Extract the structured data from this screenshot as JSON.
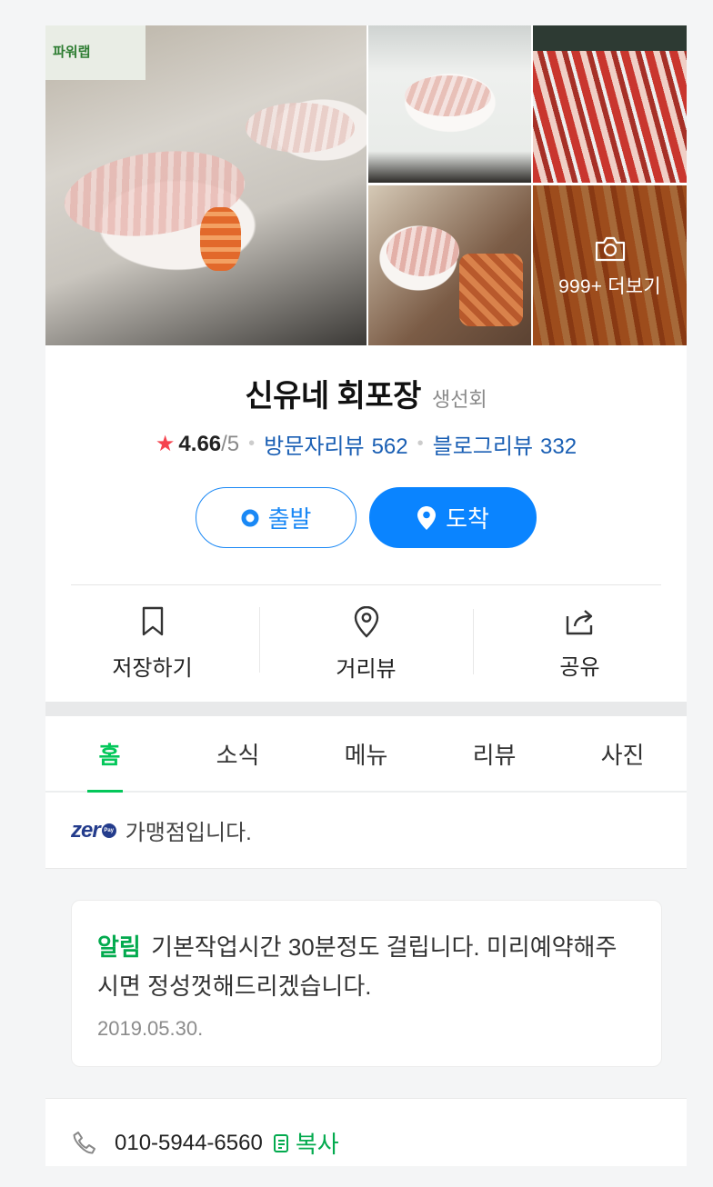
{
  "photos": {
    "more_label": "999+ 더보기",
    "main_logo_text": "파워랩"
  },
  "place": {
    "name": "신유네 회포장",
    "category": "생선회",
    "rating": "4.66",
    "rating_max": "/5",
    "visitor_review_label": "방문자리뷰",
    "visitor_review_count": "562",
    "blog_review_label": "블로그리뷰",
    "blog_review_count": "332"
  },
  "route": {
    "departure_label": "출발",
    "arrival_label": "도착"
  },
  "actions": {
    "save_label": "저장하기",
    "streetview_label": "거리뷰",
    "share_label": "공유"
  },
  "tabs": [
    {
      "label": "홈",
      "active": true
    },
    {
      "label": "소식"
    },
    {
      "label": "메뉴"
    },
    {
      "label": "리뷰"
    },
    {
      "label": "사진"
    }
  ],
  "zeropay": {
    "logo": "zer",
    "pay_badge": "Pay",
    "text": "가맹점입니다."
  },
  "notice": {
    "tag": "알림",
    "text": "기본작업시간 30분정도 걸립니다. 미리예약해주시면 정성껏해드리겠습니다.",
    "date": "2019.05.30."
  },
  "contact": {
    "phone": "010-5944-6560",
    "copy_label": "복사"
  },
  "colors": {
    "accent_green": "#03c75a",
    "route_blue": "#0a84ff",
    "link_blue": "#1a5fb4",
    "star_red": "#f5434e"
  }
}
